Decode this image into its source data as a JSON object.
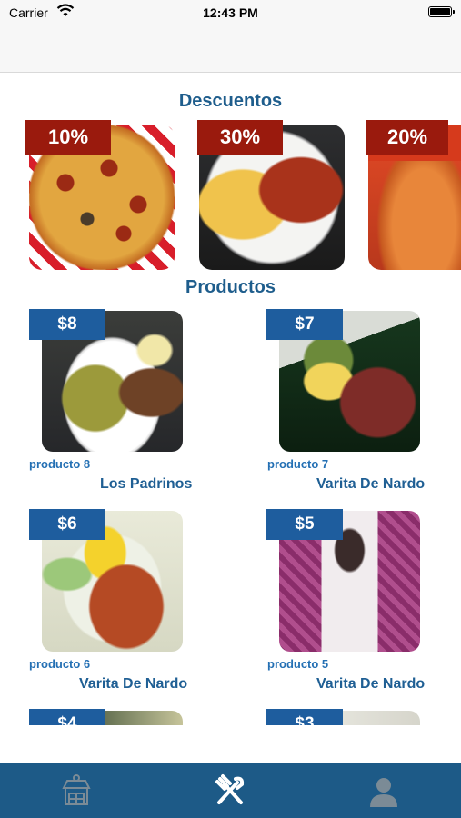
{
  "status_bar": {
    "carrier": "Carrier",
    "time": "12:43 PM"
  },
  "colors": {
    "section_title": "#1e5d8c",
    "discount_badge": "#9a1a0d",
    "price_badge": "#1e5d9e",
    "tab_bar": "#1d5a87",
    "tab_inactive_icon": "#7b8b96",
    "tab_active_icon": "#ffffff"
  },
  "descuentos": {
    "title": "Descuentos",
    "items": [
      {
        "discount": "10%",
        "image": "pizza-photo"
      },
      {
        "discount": "30%",
        "image": "wings-and-fries-photo"
      },
      {
        "discount": "20%",
        "image": "pizza-photo"
      }
    ]
  },
  "productos": {
    "title": "Productos",
    "items": [
      {
        "price": "$8",
        "name": "producto 8",
        "store": "Los Padrinos",
        "image": "enchiladas-plate-photo"
      },
      {
        "price": "$7",
        "name": "producto 7",
        "store": "Varita De Nardo",
        "image": "salad-container-photo"
      },
      {
        "price": "$6",
        "name": "producto 6",
        "store": "Varita De Nardo",
        "image": "chicken-salad-photo"
      },
      {
        "price": "$5",
        "name": "producto 5",
        "store": "Varita De Nardo",
        "image": "fruit-cup-photo"
      },
      {
        "price": "$4",
        "image": "food-photo"
      },
      {
        "price": "$3",
        "image": "food-photo"
      }
    ]
  },
  "tab_bar": {
    "tabs": [
      {
        "icon": "store-icon",
        "active": false
      },
      {
        "icon": "fork-knife-icon",
        "active": true
      },
      {
        "icon": "user-icon",
        "active": false
      }
    ]
  }
}
